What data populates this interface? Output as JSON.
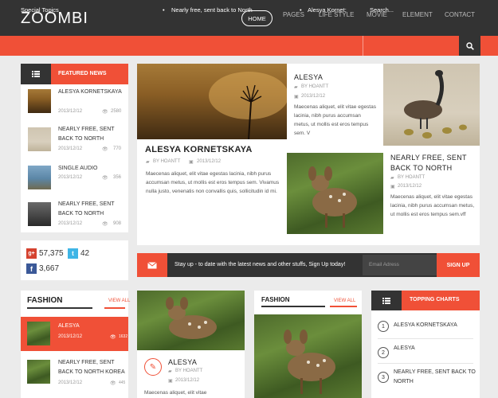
{
  "logo": "ZOOMBI",
  "nav": [
    "HOME",
    "PAGES",
    "LIFE STYLE",
    "MOVIE",
    "ELEMENT",
    "CONTACT"
  ],
  "topics": {
    "label": "Special Topics",
    "item1": "Nearly free, sent back to North",
    "item2": "Alesya Kornet:",
    "search_placeholder": "Search..."
  },
  "featured": {
    "title": "FEATURED NEWS",
    "items": [
      {
        "title": "ALESYA KORNETSKAYA",
        "date": "2013/12/12",
        "views": "2580"
      },
      {
        "title": "NEARLY FREE, SENT BACK TO NORTH",
        "date": "2013/12/12",
        "views": "770"
      },
      {
        "title": "SINGLE AUDIO",
        "date": "2013/12/12",
        "views": "356"
      },
      {
        "title": "NEARLY FREE, SENT BACK TO NORTH",
        "date": "2013/12/12",
        "views": "908"
      }
    ]
  },
  "social": {
    "gplus": "57,375",
    "twitter": "42",
    "facebook": "3,667"
  },
  "main1": {
    "title": "ALESYA KORNETSKAYA",
    "author": "BY HOANTT",
    "date": "2013/12/12",
    "text": "Maecenas aliquet, elit vitae egestas lacinia, nibh purus accumsan metus, ut mollis est eros tempus sem. Vivamus nulla justo, venenatis non convallis quis, sollicitudin id mi."
  },
  "main2": {
    "title": "ALESYA",
    "author": "BY HOANTT",
    "date": "2013/12/12",
    "text": "Maecenas aliquet, elit vitae egestas lacinia, nibh purus accumsan metus, ut mollis est eros tempus sem. V"
  },
  "main3": {
    "title": "NEARLY FREE, SENT BACK TO NORTH",
    "author": "BY HOANTT",
    "date": "2013/12/12",
    "text": "Maecenas aliquet, elit vitae egestas lacinia, nibh purus accumsan metus, ut mollis est eros tempus sem.vff"
  },
  "newsletter": {
    "text": "Stay up - to date with the latest news and other stuffs, Sign Up today!",
    "placeholder": "Email Adress",
    "button": "SIGN UP"
  },
  "fashion1": {
    "title": "FASHION",
    "view_all": "VIEW ALL",
    "items": [
      {
        "title": "ALESYA",
        "date": "2013/12/12",
        "views": "1632"
      },
      {
        "title": "NEARLY FREE, SENT BACK TO NORTH KOREA",
        "date": "2013/12/12",
        "views": "445"
      }
    ]
  },
  "fashion_mid": {
    "title": "ALESYA",
    "author": "BY HOANTT",
    "date": "2013/12/12",
    "text": "Maecenas aliquet, elit vitae"
  },
  "fashion2": {
    "title": "FASHION",
    "view_all": "VIEW ALL"
  },
  "charts": {
    "title": "TOPPING CHARTS",
    "items": [
      {
        "num": "1",
        "title": "ALESYA KORNETSKAYA"
      },
      {
        "num": "2",
        "title": "ALESYA"
      },
      {
        "num": "3",
        "title": "NEARLY FREE, SENT BACK TO NORTH"
      }
    ]
  },
  "colors": {
    "accent": "#f05037",
    "dark": "#333333"
  }
}
